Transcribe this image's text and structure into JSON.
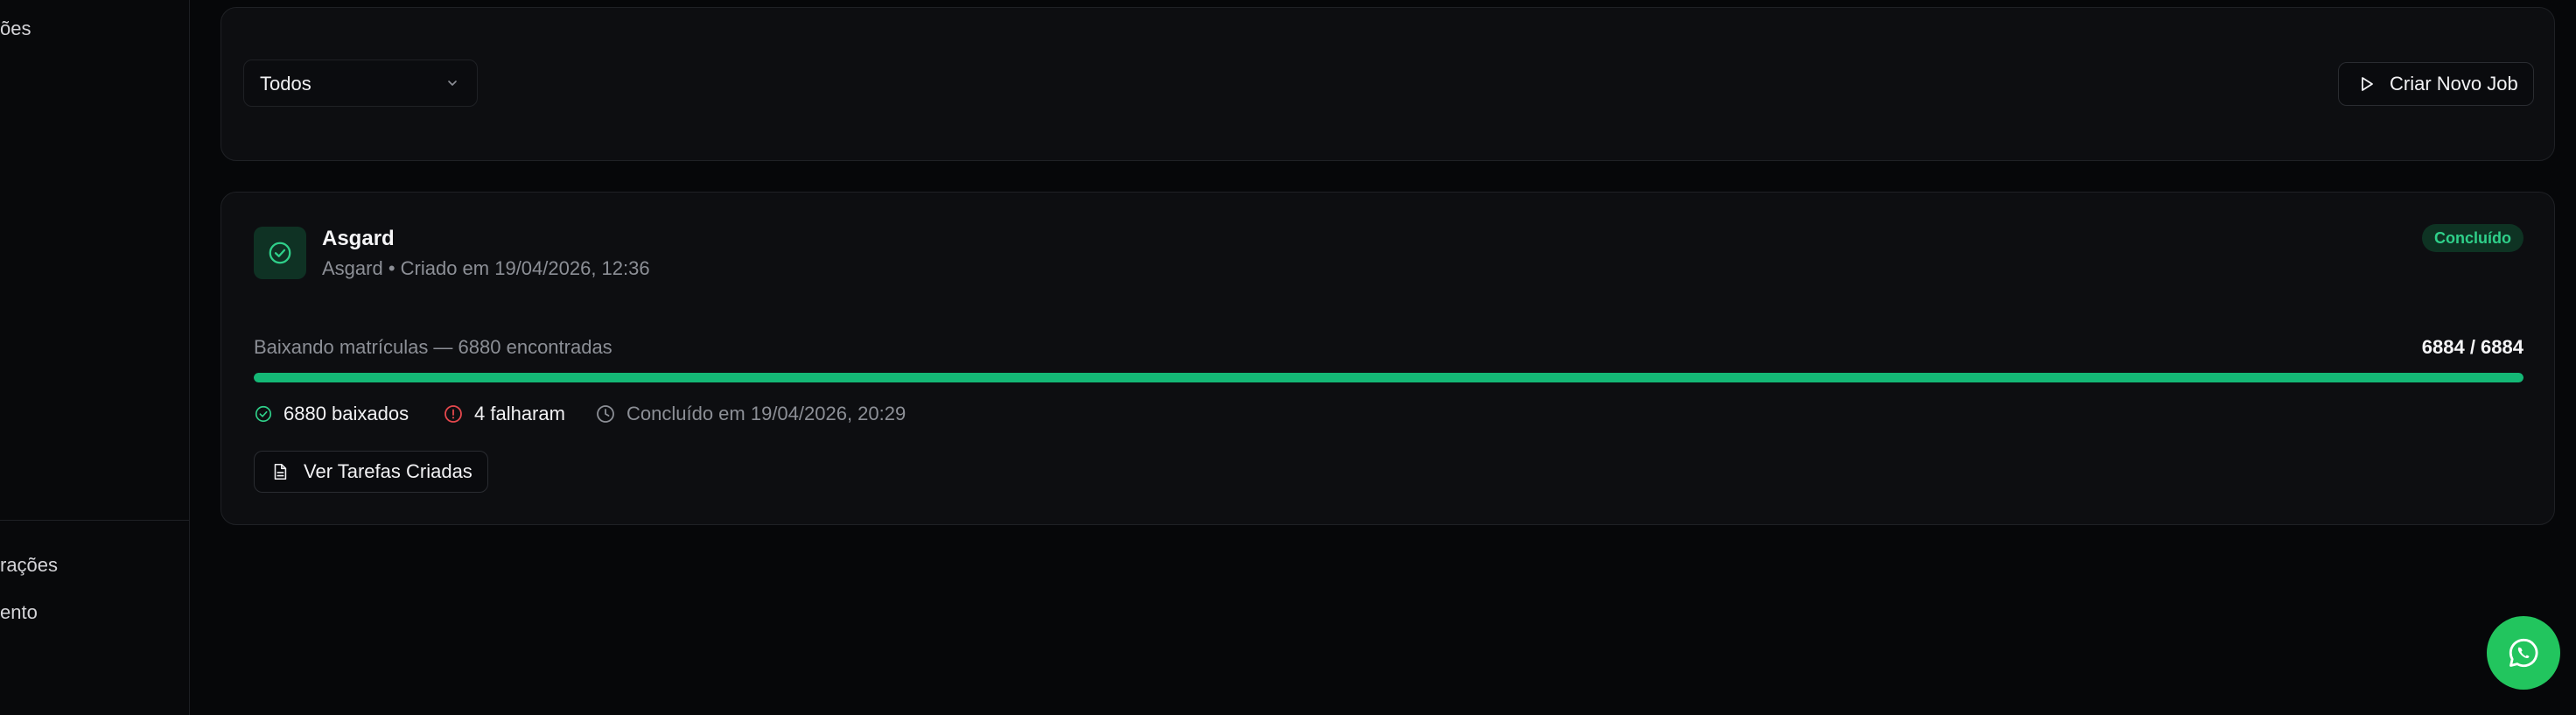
{
  "sidebar": {
    "items_top": [
      {
        "label": "ões"
      }
    ],
    "items_bottom": [
      {
        "label": "rações"
      },
      {
        "label": "ento"
      }
    ]
  },
  "filter": {
    "selected": "Todos"
  },
  "toolbar": {
    "create_job_label": "Criar Novo Job"
  },
  "job": {
    "title": "Asgard",
    "meta": "Asgard • Criado em 19/04/2026, 12:36",
    "status": "Concluído",
    "progress_label": "Baixando matrículas — 6880 encontradas",
    "progress_count": "6884 / 6884",
    "progress_fraction": 1.0,
    "stats": {
      "downloaded": "6880 baixados",
      "failed": "4 falharam",
      "completed": "Concluído em 19/04/2026, 20:29"
    },
    "view_tasks_label": "Ver Tarefas Criadas"
  },
  "colors": {
    "accent_green": "#14b876",
    "success_text": "#2fd08a",
    "error_red": "#e5484d",
    "whatsapp_green": "#22c55e"
  },
  "icons": {
    "filter_chevron": "chevron-down-icon",
    "create_job": "play-icon",
    "job_status": "check-circle-icon",
    "downloaded": "check-circle-icon",
    "failed": "alert-circle-icon",
    "completed": "clock-icon",
    "view_tasks": "file-text-icon",
    "fab": "whatsapp-icon"
  }
}
